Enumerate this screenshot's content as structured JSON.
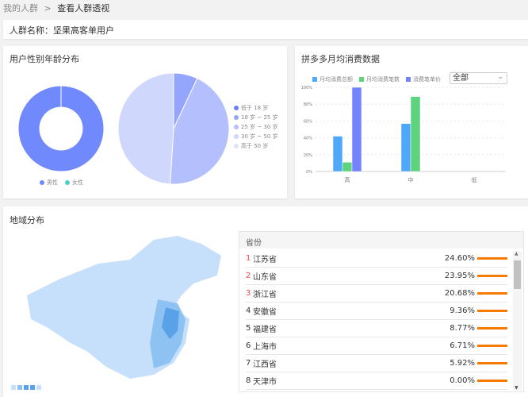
{
  "breadcrumb": {
    "parent": "我的人群",
    "sep": ">",
    "current": "查看人群透视"
  },
  "crowd": {
    "label": "人群名称：",
    "name": "坚果高客单用户"
  },
  "gender_age": {
    "title": "用户性别年龄分布",
    "gender": {
      "legend": [
        {
          "name": "男性",
          "value": 100,
          "color": "#7089fd"
        },
        {
          "name": "女性",
          "value": 0,
          "color": "#4ecdc4"
        }
      ]
    },
    "age": {
      "legend": [
        {
          "name": "低于 18 岁",
          "value": 0,
          "color": "#6a7ff8"
        },
        {
          "name": "18 岁 ~ 25 岁",
          "value": 7,
          "color": "#93a5fc"
        },
        {
          "name": "25 岁 ~ 30 岁",
          "value": 44,
          "color": "#b3c0fd"
        },
        {
          "name": "30 岁 ~ 50 岁",
          "value": 49,
          "color": "#d0d7fd"
        },
        {
          "name": "高于 50 岁",
          "value": 0,
          "color": "#dde2fb"
        }
      ]
    }
  },
  "consumption": {
    "title": "拼多多月均消费数据",
    "select": "全部",
    "chart_data": {
      "type": "bar",
      "categories": [
        "高",
        "中",
        "低"
      ],
      "ylim": [
        0,
        100
      ],
      "yticks": [
        "0%",
        "20%",
        "40%",
        "60%",
        "80%",
        "100%"
      ],
      "series": [
        {
          "name": "月均消费总额",
          "color": "#4fa8f9",
          "values": [
            42,
            57,
            0
          ]
        },
        {
          "name": "月均消费笔数",
          "color": "#5fd27e",
          "values": [
            11,
            89,
            0
          ]
        },
        {
          "name": "消费笔单价",
          "color": "#7482fb",
          "values": [
            100,
            0,
            0
          ]
        }
      ]
    }
  },
  "region": {
    "title": "地域分布",
    "column": "省份",
    "rows": [
      {
        "rank": "1",
        "name": "江苏省",
        "pct": "24.60%"
      },
      {
        "rank": "2",
        "name": "山东省",
        "pct": "23.95%"
      },
      {
        "rank": "3",
        "name": "浙江省",
        "pct": "20.68%"
      },
      {
        "rank": "4",
        "name": "安徽省",
        "pct": "9.36%"
      },
      {
        "rank": "5",
        "name": "福建省",
        "pct": "8.77%"
      },
      {
        "rank": "6",
        "name": "上海市",
        "pct": "6.71%"
      },
      {
        "rank": "7",
        "name": "江西省",
        "pct": "5.92%"
      },
      {
        "rank": "8",
        "name": "天津市",
        "pct": "0.00%"
      }
    ],
    "top_rank_color": "#f5454f",
    "bar_color": "#f97a00"
  }
}
